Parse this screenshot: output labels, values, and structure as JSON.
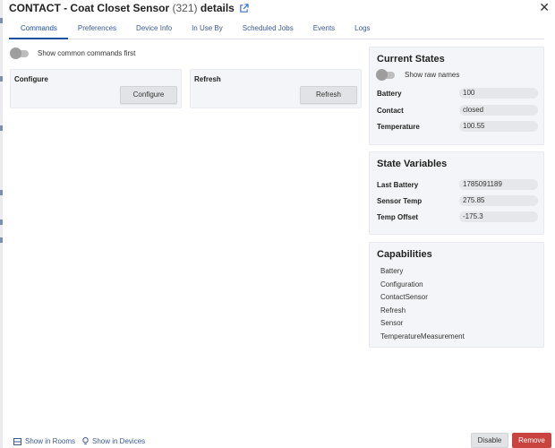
{
  "header": {
    "title_prefix": "CONTACT - Coat Closet Sensor",
    "device_id": "(321)",
    "title_suffix": "details"
  },
  "tabs": [
    {
      "label": "Commands"
    },
    {
      "label": "Preferences"
    },
    {
      "label": "Device Info"
    },
    {
      "label": "In Use By"
    },
    {
      "label": "Scheduled Jobs"
    },
    {
      "label": "Events"
    },
    {
      "label": "Logs"
    }
  ],
  "commands": {
    "common_toggle_label": "Show common commands first",
    "items": [
      {
        "title": "Configure",
        "button": "Configure"
      },
      {
        "title": "Refresh",
        "button": "Refresh"
      }
    ]
  },
  "current_states": {
    "title": "Current States",
    "raw_names_label": "Show raw names",
    "rows": [
      {
        "label": "Battery",
        "value": "100"
      },
      {
        "label": "Contact",
        "value": "closed"
      },
      {
        "label": "Temperature",
        "value": "100.55"
      }
    ]
  },
  "state_variables": {
    "title": "State Variables",
    "rows": [
      {
        "label": "Last Battery",
        "value": "1785091189"
      },
      {
        "label": "Sensor Temp",
        "value": "275.85"
      },
      {
        "label": "Temp Offset",
        "value": "-175.3"
      }
    ]
  },
  "capabilities": {
    "title": "Capabilities",
    "items": [
      "Battery",
      "Configuration",
      "ContactSensor",
      "Refresh",
      "Sensor",
      "TemperatureMeasurement"
    ]
  },
  "footer": {
    "show_in_rooms": "Show in Rooms",
    "show_in_devices": "Show in Devices",
    "disable": "Disable",
    "remove": "Remove"
  },
  "colors": {
    "accent": "#1c4fa0",
    "link": "#3b5998",
    "remove": "#c9443f",
    "card_bg": "#f4f5f8"
  }
}
